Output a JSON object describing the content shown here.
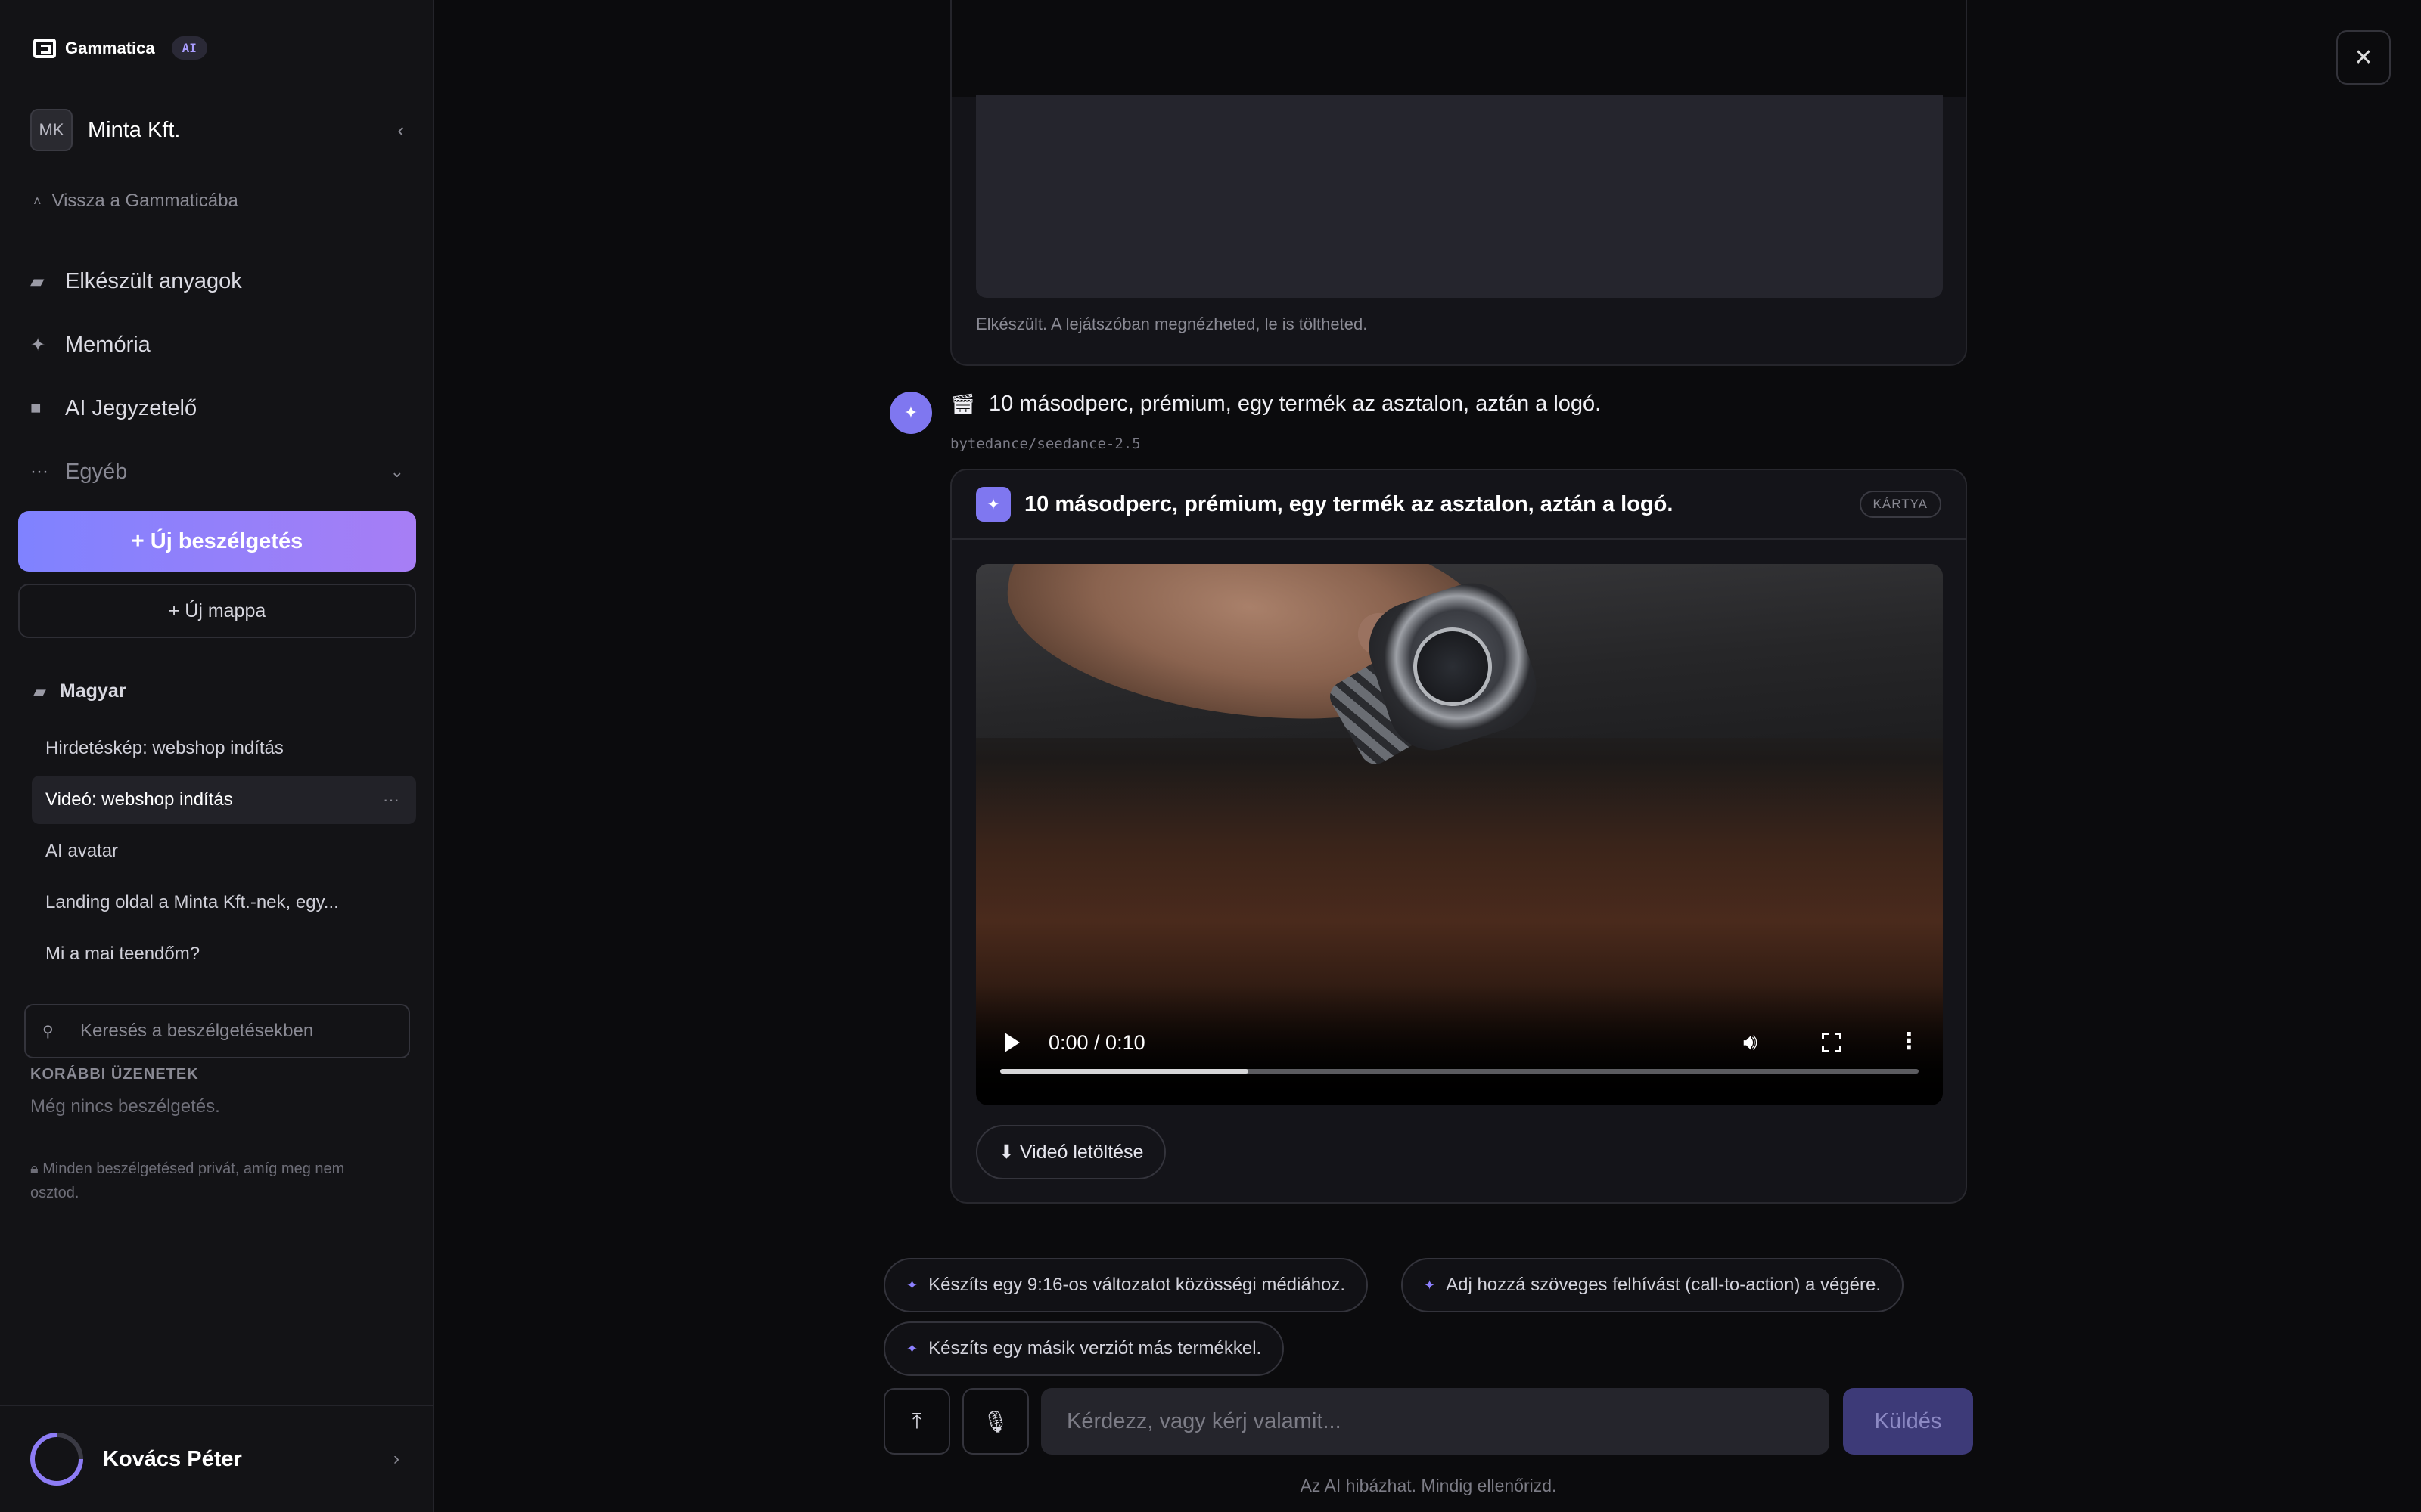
{
  "sidebar": {
    "brand": {
      "name": "Gammatica",
      "badge": "AI"
    },
    "org": {
      "initials": "MK",
      "name": "Minta Kft."
    },
    "back_link": "Vissza a Gammaticába",
    "nav": [
      {
        "label": "Elkészült anyagok",
        "icon": "folder-icon"
      },
      {
        "label": "Memória",
        "icon": "sparkle-icon"
      },
      {
        "label": "AI Jegyzetelő",
        "icon": "camera-icon"
      },
      {
        "label": "Egyéb",
        "icon": "more-icon"
      }
    ],
    "new_chat_label": "+ Új beszélgetés",
    "new_folder_label": "+ Új mappa",
    "folder_name": "Magyar",
    "chats": [
      {
        "label": "Hirdetéskép: webshop indítás"
      },
      {
        "label": "Videó: webshop indítás",
        "active": true
      },
      {
        "label": "AI avatar"
      },
      {
        "label": "Landing oldal a Minta Kft.-nek, egy..."
      },
      {
        "label": "Mi a mai teendőm?"
      }
    ],
    "search_placeholder": "Keresés a beszélgetésekben",
    "history_label": "KORÁBBI ÜZENETEK",
    "history_empty": "Még nincs beszélgetés.",
    "privacy_note": "Minden beszélgetésed privát, amíg meg nem osztod.",
    "user_name": "Kovács Péter"
  },
  "main": {
    "previous_caption": "Elkészült. A lejátszóban megnézheted, le is töltheted.",
    "message": {
      "text": "10 másodperc, prémium, egy termék az asztalon, aztán a logó.",
      "model": "bytedance/seedance-2.5"
    },
    "card": {
      "title": "10 másodperc, prémium, egy termék az asztalon, aztán a logó.",
      "badge": "KÁRTYA",
      "video_time": "0:00 / 0:10",
      "progress": 0.27,
      "download_label": "⬇ Videó letöltése"
    },
    "suggestions": [
      "Készíts egy 9:16-os változatot közösségi médiához.",
      "Adj hozzá szöveges felhívást (call-to-action) a végére.",
      "Készíts egy másik verziót más termékkel."
    ],
    "composer": {
      "placeholder": "Kérdezz, vagy kérj valamit...",
      "send_label": "Küldés"
    },
    "disclaimer": "Az AI hibázhat. Mindig ellenőrizd."
  },
  "colors": {
    "accent": "#7f77f0",
    "gradient_start": "#7f82ff",
    "gradient_end": "#a77ef5"
  }
}
